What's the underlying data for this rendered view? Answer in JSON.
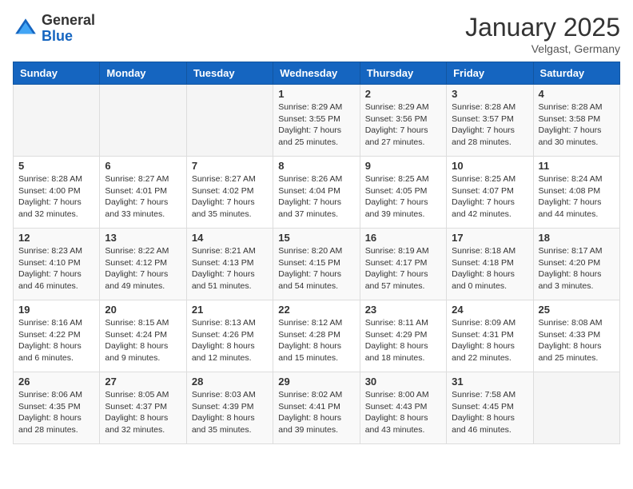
{
  "header": {
    "logo_general": "General",
    "logo_blue": "Blue",
    "month_title": "January 2025",
    "location": "Velgast, Germany"
  },
  "days_of_week": [
    "Sunday",
    "Monday",
    "Tuesday",
    "Wednesday",
    "Thursday",
    "Friday",
    "Saturday"
  ],
  "weeks": [
    {
      "days": [
        {
          "number": "",
          "sunrise": "",
          "sunset": "",
          "daylight": ""
        },
        {
          "number": "",
          "sunrise": "",
          "sunset": "",
          "daylight": ""
        },
        {
          "number": "",
          "sunrise": "",
          "sunset": "",
          "daylight": ""
        },
        {
          "number": "1",
          "sunrise": "Sunrise: 8:29 AM",
          "sunset": "Sunset: 3:55 PM",
          "daylight": "Daylight: 7 hours and 25 minutes."
        },
        {
          "number": "2",
          "sunrise": "Sunrise: 8:29 AM",
          "sunset": "Sunset: 3:56 PM",
          "daylight": "Daylight: 7 hours and 27 minutes."
        },
        {
          "number": "3",
          "sunrise": "Sunrise: 8:28 AM",
          "sunset": "Sunset: 3:57 PM",
          "daylight": "Daylight: 7 hours and 28 minutes."
        },
        {
          "number": "4",
          "sunrise": "Sunrise: 8:28 AM",
          "sunset": "Sunset: 3:58 PM",
          "daylight": "Daylight: 7 hours and 30 minutes."
        }
      ]
    },
    {
      "days": [
        {
          "number": "5",
          "sunrise": "Sunrise: 8:28 AM",
          "sunset": "Sunset: 4:00 PM",
          "daylight": "Daylight: 7 hours and 32 minutes."
        },
        {
          "number": "6",
          "sunrise": "Sunrise: 8:27 AM",
          "sunset": "Sunset: 4:01 PM",
          "daylight": "Daylight: 7 hours and 33 minutes."
        },
        {
          "number": "7",
          "sunrise": "Sunrise: 8:27 AM",
          "sunset": "Sunset: 4:02 PM",
          "daylight": "Daylight: 7 hours and 35 minutes."
        },
        {
          "number": "8",
          "sunrise": "Sunrise: 8:26 AM",
          "sunset": "Sunset: 4:04 PM",
          "daylight": "Daylight: 7 hours and 37 minutes."
        },
        {
          "number": "9",
          "sunrise": "Sunrise: 8:25 AM",
          "sunset": "Sunset: 4:05 PM",
          "daylight": "Daylight: 7 hours and 39 minutes."
        },
        {
          "number": "10",
          "sunrise": "Sunrise: 8:25 AM",
          "sunset": "Sunset: 4:07 PM",
          "daylight": "Daylight: 7 hours and 42 minutes."
        },
        {
          "number": "11",
          "sunrise": "Sunrise: 8:24 AM",
          "sunset": "Sunset: 4:08 PM",
          "daylight": "Daylight: 7 hours and 44 minutes."
        }
      ]
    },
    {
      "days": [
        {
          "number": "12",
          "sunrise": "Sunrise: 8:23 AM",
          "sunset": "Sunset: 4:10 PM",
          "daylight": "Daylight: 7 hours and 46 minutes."
        },
        {
          "number": "13",
          "sunrise": "Sunrise: 8:22 AM",
          "sunset": "Sunset: 4:12 PM",
          "daylight": "Daylight: 7 hours and 49 minutes."
        },
        {
          "number": "14",
          "sunrise": "Sunrise: 8:21 AM",
          "sunset": "Sunset: 4:13 PM",
          "daylight": "Daylight: 7 hours and 51 minutes."
        },
        {
          "number": "15",
          "sunrise": "Sunrise: 8:20 AM",
          "sunset": "Sunset: 4:15 PM",
          "daylight": "Daylight: 7 hours and 54 minutes."
        },
        {
          "number": "16",
          "sunrise": "Sunrise: 8:19 AM",
          "sunset": "Sunset: 4:17 PM",
          "daylight": "Daylight: 7 hours and 57 minutes."
        },
        {
          "number": "17",
          "sunrise": "Sunrise: 8:18 AM",
          "sunset": "Sunset: 4:18 PM",
          "daylight": "Daylight: 8 hours and 0 minutes."
        },
        {
          "number": "18",
          "sunrise": "Sunrise: 8:17 AM",
          "sunset": "Sunset: 4:20 PM",
          "daylight": "Daylight: 8 hours and 3 minutes."
        }
      ]
    },
    {
      "days": [
        {
          "number": "19",
          "sunrise": "Sunrise: 8:16 AM",
          "sunset": "Sunset: 4:22 PM",
          "daylight": "Daylight: 8 hours and 6 minutes."
        },
        {
          "number": "20",
          "sunrise": "Sunrise: 8:15 AM",
          "sunset": "Sunset: 4:24 PM",
          "daylight": "Daylight: 8 hours and 9 minutes."
        },
        {
          "number": "21",
          "sunrise": "Sunrise: 8:13 AM",
          "sunset": "Sunset: 4:26 PM",
          "daylight": "Daylight: 8 hours and 12 minutes."
        },
        {
          "number": "22",
          "sunrise": "Sunrise: 8:12 AM",
          "sunset": "Sunset: 4:28 PM",
          "daylight": "Daylight: 8 hours and 15 minutes."
        },
        {
          "number": "23",
          "sunrise": "Sunrise: 8:11 AM",
          "sunset": "Sunset: 4:29 PM",
          "daylight": "Daylight: 8 hours and 18 minutes."
        },
        {
          "number": "24",
          "sunrise": "Sunrise: 8:09 AM",
          "sunset": "Sunset: 4:31 PM",
          "daylight": "Daylight: 8 hours and 22 minutes."
        },
        {
          "number": "25",
          "sunrise": "Sunrise: 8:08 AM",
          "sunset": "Sunset: 4:33 PM",
          "daylight": "Daylight: 8 hours and 25 minutes."
        }
      ]
    },
    {
      "days": [
        {
          "number": "26",
          "sunrise": "Sunrise: 8:06 AM",
          "sunset": "Sunset: 4:35 PM",
          "daylight": "Daylight: 8 hours and 28 minutes."
        },
        {
          "number": "27",
          "sunrise": "Sunrise: 8:05 AM",
          "sunset": "Sunset: 4:37 PM",
          "daylight": "Daylight: 8 hours and 32 minutes."
        },
        {
          "number": "28",
          "sunrise": "Sunrise: 8:03 AM",
          "sunset": "Sunset: 4:39 PM",
          "daylight": "Daylight: 8 hours and 35 minutes."
        },
        {
          "number": "29",
          "sunrise": "Sunrise: 8:02 AM",
          "sunset": "Sunset: 4:41 PM",
          "daylight": "Daylight: 8 hours and 39 minutes."
        },
        {
          "number": "30",
          "sunrise": "Sunrise: 8:00 AM",
          "sunset": "Sunset: 4:43 PM",
          "daylight": "Daylight: 8 hours and 43 minutes."
        },
        {
          "number": "31",
          "sunrise": "Sunrise: 7:58 AM",
          "sunset": "Sunset: 4:45 PM",
          "daylight": "Daylight: 8 hours and 46 minutes."
        },
        {
          "number": "",
          "sunrise": "",
          "sunset": "",
          "daylight": ""
        }
      ]
    }
  ]
}
